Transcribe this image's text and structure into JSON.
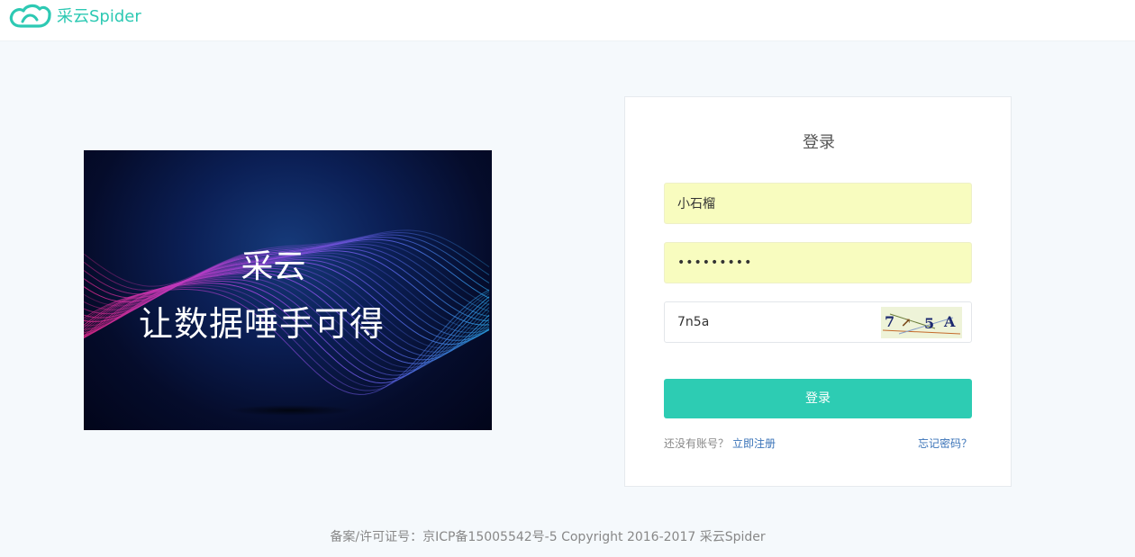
{
  "brand": {
    "name": "采云Spider",
    "color": "#2dc9b3"
  },
  "banner": {
    "line1": "采云",
    "line2": "让数据唾手可得"
  },
  "login": {
    "title": "登录",
    "username_value": "小石榴",
    "password_mask": "•••••••••",
    "captcha_value": "7n5a",
    "captcha_image_text": "7 5 A",
    "submit_label": "登录",
    "no_account_text": "还没有账号？",
    "register_label": "立即注册",
    "forgot_label": "忘记密码？",
    "accent_color": "#2dccb3"
  },
  "footer": {
    "text": "备案/许可证号：京ICP备15005542号-5 Copyright 2016-2017 采云Spider"
  }
}
